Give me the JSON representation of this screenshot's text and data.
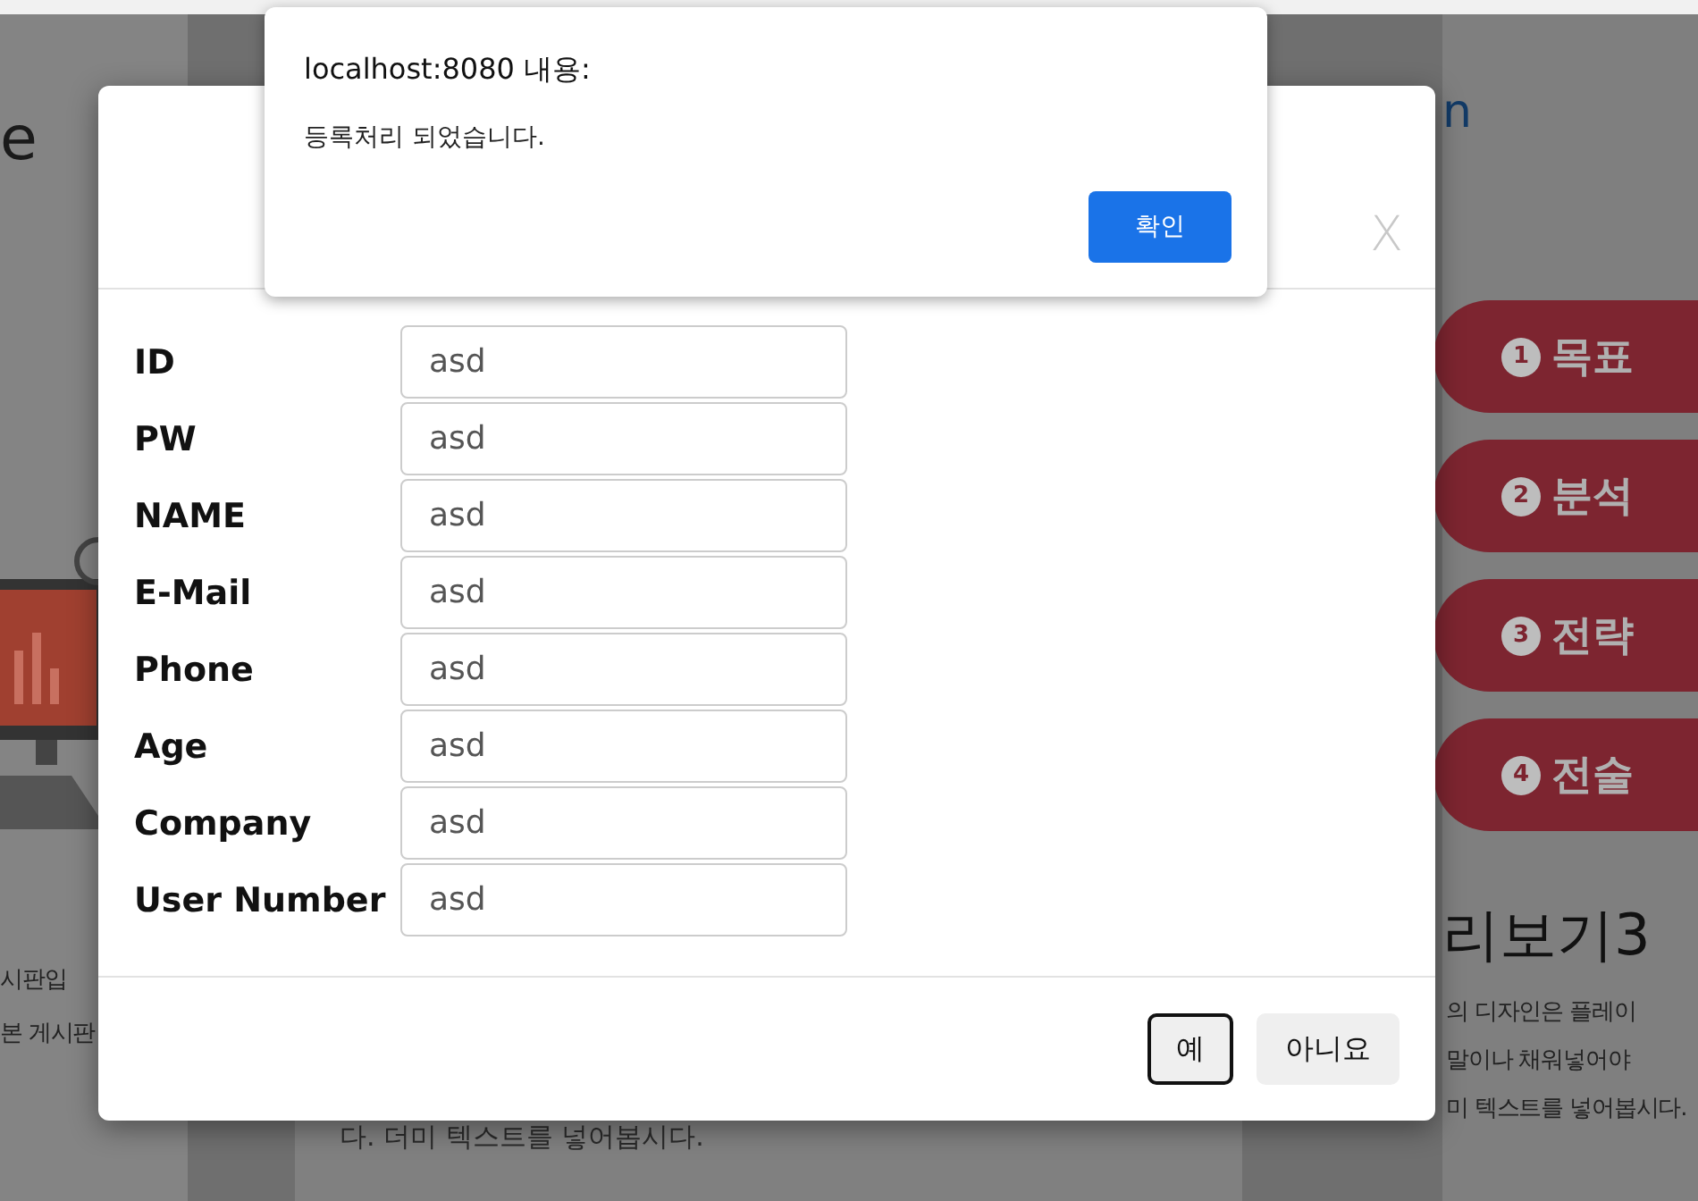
{
  "page": {
    "heading_fragment": "e",
    "link_fragment": "n",
    "left_text": [
      "시판입",
      "본 게시판"
    ],
    "center_text": "다. 더미 텍스트를 넣어봅시다.",
    "steps": [
      {
        "number": "1",
        "label": "목표"
      },
      {
        "number": "2",
        "label": "분석"
      },
      {
        "number": "3",
        "label": "전략"
      },
      {
        "number": "4",
        "label": "전술"
      }
    ],
    "preview_title": "리보기3",
    "right_text": [
      "의 디자인은 플레이",
      "말이나 채워넣어야",
      "미 텍스트를 넣어봅시다."
    ]
  },
  "modal": {
    "close": "X",
    "fields": [
      {
        "label": "ID",
        "value": "asd"
      },
      {
        "label": "PW",
        "value": "asd"
      },
      {
        "label": "NAME",
        "value": "asd"
      },
      {
        "label": "E-Mail",
        "value": "asd"
      },
      {
        "label": "Phone",
        "value": "asd"
      },
      {
        "label": "Age",
        "value": "asd"
      },
      {
        "label": "Company",
        "value": "asd"
      },
      {
        "label": "User Number",
        "value": "asd"
      }
    ],
    "buttons": [
      {
        "label": "예",
        "focused": true
      },
      {
        "label": "아니요",
        "focused": false
      }
    ]
  },
  "alert": {
    "title": "localhost:8080 내용:",
    "message": "등록처리 되었습니다.",
    "button": "확인"
  }
}
